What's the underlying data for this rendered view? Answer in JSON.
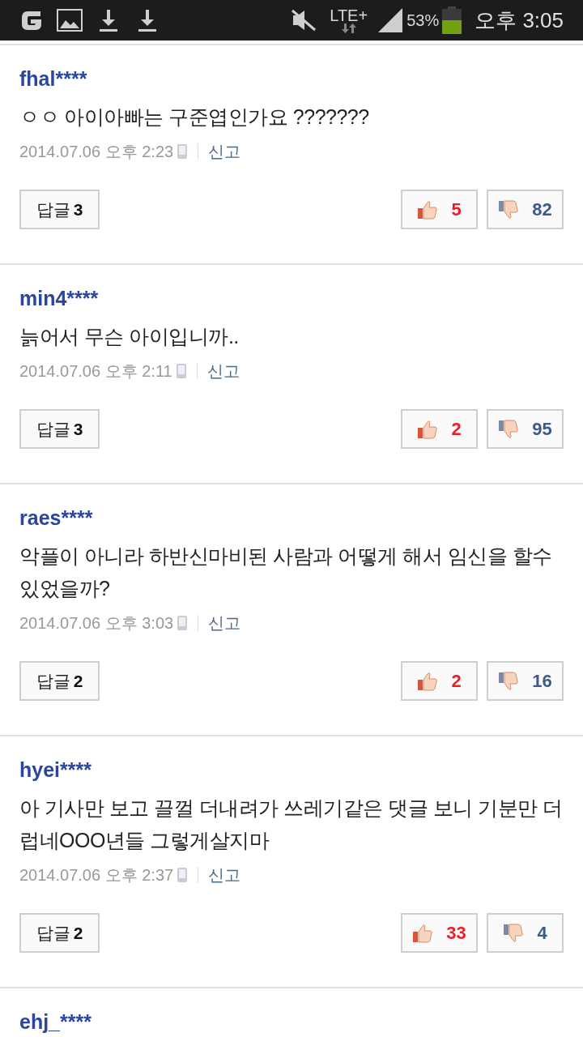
{
  "status_bar": {
    "network": "LTE+",
    "battery": "53%",
    "time": "오후 3:05"
  },
  "comments": [
    {
      "user": "fhal****",
      "text": "ㅇㅇ 아이아빠는 구준엽인가요 ???????",
      "date": "2014.07.06 오후 2:23",
      "report": "신고",
      "reply_label": "답글",
      "reply_count": "3",
      "likes": "5",
      "dislikes": "82"
    },
    {
      "user": "min4****",
      "text": "늙어서 무슨 아이입니까..",
      "date": "2014.07.06 오후 2:11",
      "report": "신고",
      "reply_label": "답글",
      "reply_count": "3",
      "likes": "2",
      "dislikes": "95"
    },
    {
      "user": "raes****",
      "text": "악플이 아니라 하반신마비된 사람과 어떻게 해서 임신을 할수 있었을까?",
      "date": "2014.07.06 오후 3:03",
      "report": "신고",
      "reply_label": "답글",
      "reply_count": "2",
      "likes": "2",
      "dislikes": "16"
    },
    {
      "user": "hyei****",
      "text": "아 기사만 보고 끌껄 더내려가 쓰레기같은 댓글 보니 기분만 더럽네OOO년들 그렇게살지마",
      "date": "2014.07.06 오후 2:37",
      "report": "신고",
      "reply_label": "답글",
      "reply_count": "2",
      "likes": "33",
      "dislikes": "4"
    }
  ],
  "partial_comment": {
    "user": "ehj_****"
  }
}
